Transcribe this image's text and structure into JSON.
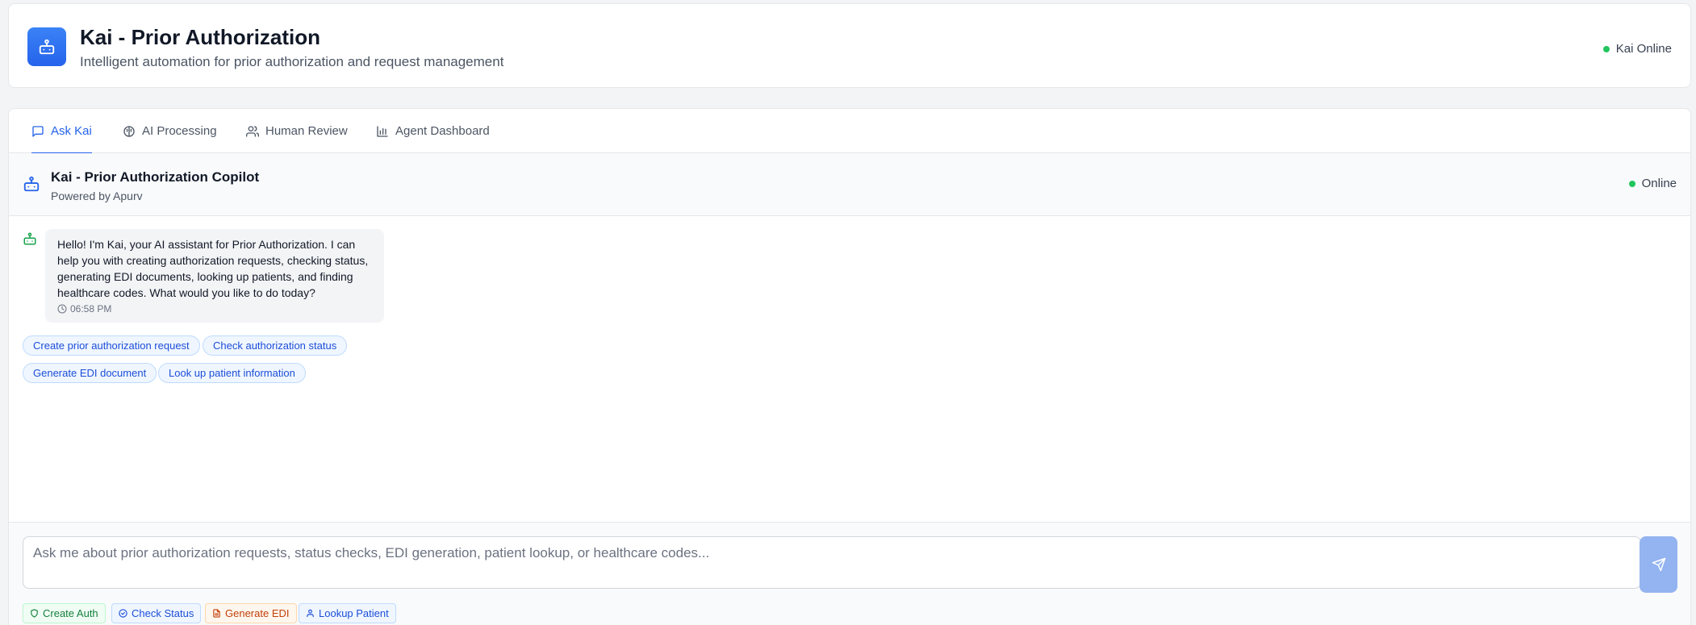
{
  "header": {
    "title": "Kai - Prior Authorization",
    "subtitle": "Intelligent automation for prior authorization and request management",
    "status": "Kai Online",
    "logo_icon": "robot-icon",
    "accent": "#2563eb"
  },
  "tabs": [
    {
      "label": "Ask Kai",
      "icon": "message-icon",
      "active": true
    },
    {
      "label": "AI Processing",
      "icon": "brain-icon",
      "active": false
    },
    {
      "label": "Human Review",
      "icon": "users-icon",
      "active": false
    },
    {
      "label": "Agent Dashboard",
      "icon": "bar-chart-icon",
      "active": false
    }
  ],
  "chat": {
    "title": "Kai - Prior Authorization Copilot",
    "subtitle": "Powered by Apurv",
    "status": "Online",
    "status_color": "#22c55e"
  },
  "messages": [
    {
      "sender": "bot",
      "text": "Hello! I'm Kai, your AI assistant for Prior Authorization. I can help you with creating authorization requests, checking status, generating EDI documents, looking up patients, and finding healthcare codes. What would you like to do today?",
      "time": "06:58 PM"
    }
  ],
  "suggestions": [
    "Create prior authorization request",
    "Check authorization status",
    "Generate EDI document",
    "Look up patient information"
  ],
  "input": {
    "placeholder": "Ask me about prior authorization requests, status checks, EDI generation, patient lookup, or healthcare codes...",
    "value": ""
  },
  "quick_actions": [
    {
      "label": "Create Auth",
      "icon": "shield-icon",
      "color": "#15803d"
    },
    {
      "label": "Check Status",
      "icon": "check-circle-icon",
      "color": "#1d4ed8"
    },
    {
      "label": "Generate EDI",
      "icon": "file-icon",
      "color": "#c2410c"
    },
    {
      "label": "Lookup Patient",
      "icon": "user-icon",
      "color": "#1d4ed8"
    }
  ]
}
